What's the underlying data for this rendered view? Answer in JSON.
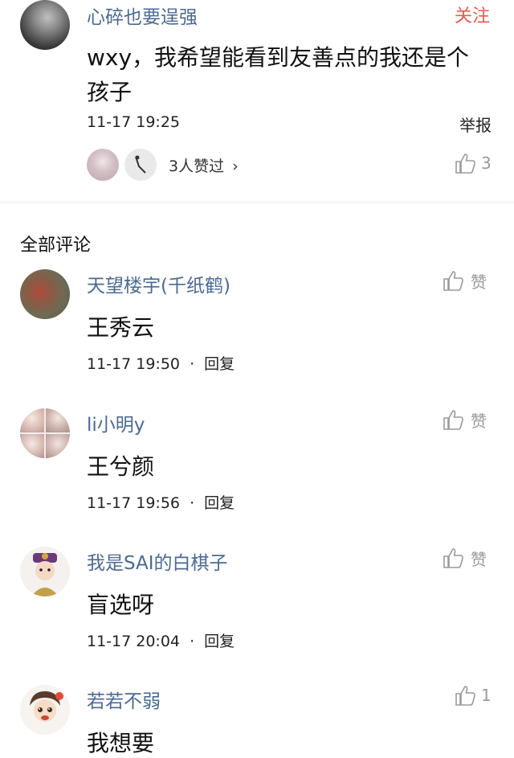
{
  "post": {
    "author": "心碎也要逞强",
    "follow_label": "关注",
    "content_line1": "wxy，我希望能看到友善点的我还是个",
    "content_line2": "孩子",
    "time": "11-17 19:25",
    "report_label": "举报",
    "likers_text": "3人赞过",
    "likers_chevron": "›",
    "like_count": "3"
  },
  "section_title": "全部评论",
  "comments": [
    {
      "name": "天望楼宇(千纸鹤)",
      "content": "王秀云",
      "time": "11-17 19:50",
      "sep": "·",
      "reply": "回复",
      "like": "赞"
    },
    {
      "name": "li小明y",
      "content": "王兮颜",
      "time": "11-17 19:56",
      "sep": "·",
      "reply": "回复",
      "like": "赞"
    },
    {
      "name": "我是SAI的白棋子",
      "content": "盲选呀",
      "time": "11-17 20:04",
      "sep": "·",
      "reply": "回复",
      "like": "赞"
    },
    {
      "name": "若若不弱",
      "content": "我想要",
      "like": "1"
    }
  ],
  "colors": {
    "name": "#4a6a94",
    "follow": "#e85a4f",
    "like_icon": "#9a9a9a"
  }
}
